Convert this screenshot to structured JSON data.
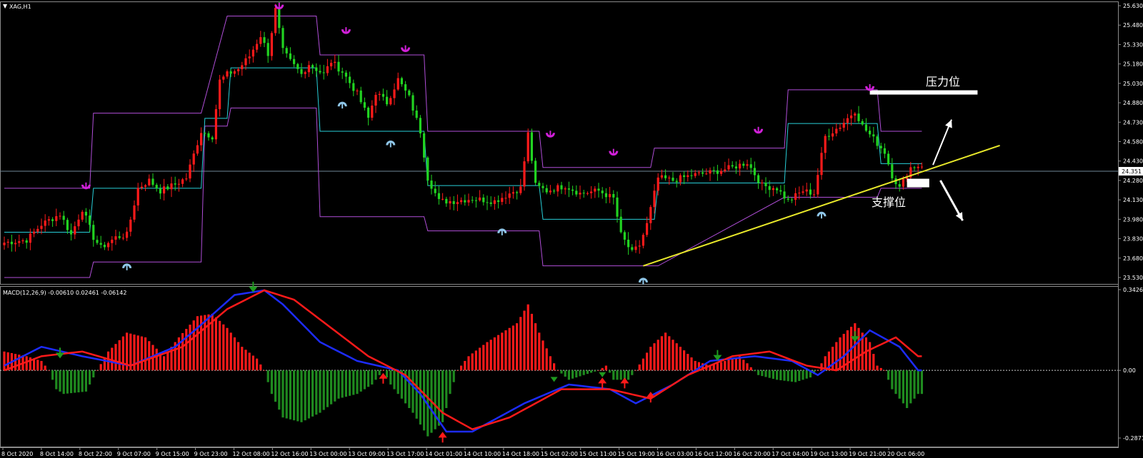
{
  "window": {
    "symbol_label": "XAG,H1",
    "macd_label": "MACD(12,26,9) -0.00610 0.02461 -0.06142"
  },
  "annotations": {
    "resistance": "压力位",
    "support": "支撑位"
  },
  "price_axis": {
    "ticks": [
      "25.630",
      "25.480",
      "25.330",
      "25.180",
      "25.030",
      "24.880",
      "24.730",
      "24.580",
      "24.430",
      "24.280",
      "24.130",
      "23.980",
      "23.830",
      "23.680",
      "23.530"
    ],
    "current": "24.351"
  },
  "macd_axis": {
    "ticks": [
      "0.34265",
      "0.00",
      "-0.28719"
    ]
  },
  "time_axis": {
    "ticks": [
      "8 Oct 2020",
      "8 Oct 14:00",
      "8 Oct 22:00",
      "9 Oct 07:00",
      "9 Oct 15:00",
      "9 Oct 23:00",
      "12 Oct 08:00",
      "12 Oct 16:00",
      "13 Oct 00:00",
      "13 Oct 09:00",
      "13 Oct 17:00",
      "14 Oct 01:00",
      "14 Oct 10:00",
      "14 Oct 18:00",
      "15 Oct 02:00",
      "15 Oct 11:00",
      "15 Oct 19:00",
      "16 Oct 03:00",
      "16 Oct 12:00",
      "16 Oct 20:00",
      "17 Oct 04:00",
      "19 Oct 13:00",
      "19 Oct 21:00",
      "20 Oct 06:00"
    ]
  },
  "colors": {
    "up": "#ff1a1a",
    "down": "#21d321",
    "upper_band": "#b04ed8",
    "mid_band": "#28cfd8",
    "trend": "#e8e82a",
    "macd": "#1d2cff",
    "signal": "#ff1a1a",
    "hist_pos": "#ff1a1a",
    "hist_neg": "#1f8a1f"
  },
  "chart_data": [
    {
      "type": "candlestick",
      "symbol": "XAG",
      "timeframe": "H1",
      "ylim": [
        23.53,
        25.63
      ],
      "current_price": 24.351,
      "anchors": [
        [
          0,
          23.8
        ],
        [
          6,
          23.82
        ],
        [
          10,
          23.94
        ],
        [
          15,
          24.02
        ],
        [
          18,
          23.86
        ],
        [
          21,
          24.06
        ],
        [
          24,
          23.84
        ],
        [
          26,
          23.76
        ],
        [
          30,
          23.84
        ],
        [
          33,
          23.86
        ],
        [
          36,
          24.22
        ],
        [
          39,
          24.28
        ],
        [
          42,
          24.2
        ],
        [
          46,
          24.25
        ],
        [
          49,
          24.3
        ],
        [
          53,
          24.66
        ],
        [
          56,
          24.62
        ],
        [
          58,
          25.05
        ],
        [
          60,
          25.1
        ],
        [
          63,
          25.14
        ],
        [
          66,
          25.24
        ],
        [
          69,
          25.4
        ],
        [
          71,
          25.26
        ],
        [
          73,
          25.6
        ],
        [
          75,
          25.28
        ],
        [
          77,
          25.2
        ],
        [
          80,
          25.1
        ],
        [
          82,
          25.18
        ],
        [
          86,
          25.1
        ],
        [
          88,
          25.2
        ],
        [
          91,
          25.12
        ],
        [
          95,
          24.95
        ],
        [
          98,
          24.76
        ],
        [
          100,
          24.96
        ],
        [
          103,
          24.88
        ],
        [
          106,
          25.06
        ],
        [
          109,
          24.92
        ],
        [
          112,
          24.66
        ],
        [
          114,
          24.3
        ],
        [
          117,
          24.12
        ],
        [
          121,
          24.12
        ],
        [
          126,
          24.14
        ],
        [
          132,
          24.12
        ],
        [
          136,
          24.18
        ],
        [
          139,
          24.22
        ],
        [
          141,
          24.64
        ],
        [
          143,
          24.24
        ],
        [
          146,
          24.2
        ],
        [
          151,
          24.24
        ],
        [
          155,
          24.18
        ],
        [
          160,
          24.2
        ],
        [
          164,
          24.14
        ],
        [
          166,
          23.86
        ],
        [
          169,
          23.72
        ],
        [
          171,
          23.78
        ],
        [
          173,
          23.94
        ],
        [
          176,
          24.3
        ],
        [
          180,
          24.28
        ],
        [
          185,
          24.32
        ],
        [
          190,
          24.34
        ],
        [
          196,
          24.38
        ],
        [
          200,
          24.42
        ],
        [
          204,
          24.24
        ],
        [
          208,
          24.22
        ],
        [
          211,
          24.12
        ],
        [
          215,
          24.2
        ],
        [
          218,
          24.18
        ],
        [
          221,
          24.62
        ],
        [
          225,
          24.7
        ],
        [
          229,
          24.82
        ],
        [
          231,
          24.7
        ],
        [
          234,
          24.6
        ],
        [
          237,
          24.5
        ],
        [
          239,
          24.32
        ],
        [
          241,
          24.22
        ],
        [
          244,
          24.38
        ],
        [
          247,
          24.4
        ]
      ],
      "upper_band_steps": [
        [
          0,
          24.22
        ],
        [
          23,
          24.22
        ],
        [
          24,
          24.8
        ],
        [
          53,
          24.8
        ],
        [
          60,
          25.55
        ],
        [
          84,
          25.55
        ],
        [
          85,
          25.25
        ],
        [
          113,
          25.25
        ],
        [
          114,
          24.66
        ],
        [
          144,
          24.66
        ],
        [
          145,
          24.38
        ],
        [
          174,
          24.38
        ],
        [
          175,
          24.53
        ],
        [
          210,
          24.53
        ],
        [
          211,
          24.98
        ],
        [
          235,
          24.98
        ],
        [
          236,
          24.66
        ],
        [
          247,
          24.66
        ]
      ],
      "mid_band_steps": [
        [
          0,
          23.88
        ],
        [
          23,
          23.88
        ],
        [
          24,
          24.22
        ],
        [
          53,
          24.22
        ],
        [
          54,
          24.76
        ],
        [
          60,
          24.76
        ],
        [
          61,
          25.15
        ],
        [
          84,
          25.15
        ],
        [
          85,
          24.66
        ],
        [
          113,
          24.66
        ],
        [
          114,
          24.24
        ],
        [
          144,
          24.24
        ],
        [
          145,
          23.98
        ],
        [
          175,
          23.98
        ],
        [
          176,
          24.26
        ],
        [
          210,
          24.26
        ],
        [
          211,
          24.72
        ],
        [
          235,
          24.72
        ],
        [
          236,
          24.41
        ],
        [
          247,
          24.41
        ]
      ],
      "lower_band_steps": [
        [
          0,
          23.53
        ],
        [
          23,
          23.53
        ],
        [
          24,
          23.65
        ],
        [
          53,
          23.65
        ],
        [
          54,
          24.7
        ],
        [
          60,
          24.7
        ],
        [
          61,
          24.84
        ],
        [
          84,
          24.84
        ],
        [
          85,
          24.0
        ],
        [
          113,
          24.0
        ],
        [
          114,
          23.89
        ],
        [
          144,
          23.89
        ],
        [
          145,
          23.62
        ],
        [
          175,
          23.62
        ],
        [
          176,
          23.62
        ],
        [
          210,
          24.15
        ],
        [
          211,
          24.15
        ],
        [
          235,
          24.15
        ],
        [
          236,
          24.22
        ],
        [
          247,
          24.22
        ]
      ],
      "fractal_up_signals": [
        [
          22,
          24.22
        ],
        [
          74,
          25.61
        ],
        [
          92,
          25.42
        ],
        [
          108,
          25.28
        ],
        [
          147,
          24.62
        ],
        [
          164,
          24.48
        ],
        [
          203,
          24.65
        ],
        [
          233,
          24.98
        ]
      ],
      "fractal_down_signals": [
        [
          33,
          23.63
        ],
        [
          91,
          24.88
        ],
        [
          104,
          24.58
        ],
        [
          134,
          23.9
        ],
        [
          172,
          23.52
        ],
        [
          220,
          24.03
        ]
      ],
      "trendline": [
        [
          172,
          23.62
        ],
        [
          268,
          24.55
        ]
      ],
      "arrows": [
        [
          250,
          24.4,
          255,
          24.75
        ],
        [
          252,
          24.28,
          258,
          23.97
        ]
      ],
      "resistance_bar": [
        233,
        262,
        24.96
      ],
      "support_bar": [
        243,
        249,
        24.26
      ]
    },
    {
      "type": "macd",
      "params": [
        12,
        26,
        9
      ],
      "values": {
        "macd": -0.0061,
        "signal": 0.02461,
        "histogram": -0.06142
      },
      "ylim": [
        -0.28719,
        0.34265
      ],
      "macd_anchors": [
        [
          0,
          0.02
        ],
        [
          10,
          0.1
        ],
        [
          21,
          0.06
        ],
        [
          34,
          0.02
        ],
        [
          46,
          0.1
        ],
        [
          52,
          0.18
        ],
        [
          62,
          0.32
        ],
        [
          70,
          0.34
        ],
        [
          75,
          0.28
        ],
        [
          85,
          0.12
        ],
        [
          95,
          0.04
        ],
        [
          106,
          0.0
        ],
        [
          112,
          -0.1
        ],
        [
          119,
          -0.26
        ],
        [
          126,
          -0.26
        ],
        [
          140,
          -0.14
        ],
        [
          152,
          -0.06
        ],
        [
          163,
          -0.08
        ],
        [
          170,
          -0.14
        ],
        [
          180,
          -0.06
        ],
        [
          190,
          0.04
        ],
        [
          202,
          0.06
        ],
        [
          212,
          0.04
        ],
        [
          219,
          -0.02
        ],
        [
          226,
          0.06
        ],
        [
          233,
          0.17
        ],
        [
          241,
          0.1
        ],
        [
          246,
          0.0
        ]
      ],
      "signal_anchors": [
        [
          0,
          0.0
        ],
        [
          10,
          0.06
        ],
        [
          21,
          0.08
        ],
        [
          34,
          0.02
        ],
        [
          48,
          0.1
        ],
        [
          60,
          0.26
        ],
        [
          70,
          0.34
        ],
        [
          78,
          0.3
        ],
        [
          88,
          0.18
        ],
        [
          98,
          0.06
        ],
        [
          108,
          -0.02
        ],
        [
          118,
          -0.18
        ],
        [
          126,
          -0.25
        ],
        [
          136,
          -0.2
        ],
        [
          150,
          -0.08
        ],
        [
          163,
          -0.08
        ],
        [
          174,
          -0.12
        ],
        [
          184,
          -0.02
        ],
        [
          196,
          0.06
        ],
        [
          206,
          0.08
        ],
        [
          216,
          0.02
        ],
        [
          224,
          0.0
        ],
        [
          232,
          0.08
        ],
        [
          240,
          0.14
        ],
        [
          246,
          0.06
        ]
      ],
      "hist_anchors": [
        [
          0,
          0.08
        ],
        [
          6,
          0.06
        ],
        [
          10,
          0.04
        ],
        [
          12,
          0.0
        ],
        [
          14,
          -0.08
        ],
        [
          16,
          -0.1
        ],
        [
          22,
          -0.09
        ],
        [
          25,
          0.0
        ],
        [
          28,
          0.08
        ],
        [
          33,
          0.16
        ],
        [
          38,
          0.14
        ],
        [
          43,
          0.06
        ],
        [
          47,
          0.14
        ],
        [
          52,
          0.23
        ],
        [
          56,
          0.24
        ],
        [
          60,
          0.18
        ],
        [
          64,
          0.1
        ],
        [
          68,
          0.05
        ],
        [
          70,
          0.0
        ],
        [
          72,
          -0.1
        ],
        [
          75,
          -0.2
        ],
        [
          80,
          -0.22
        ],
        [
          85,
          -0.18
        ],
        [
          90,
          -0.12
        ],
        [
          95,
          -0.1
        ],
        [
          99,
          -0.06
        ],
        [
          102,
          0.0
        ],
        [
          104,
          -0.06
        ],
        [
          110,
          -0.18
        ],
        [
          114,
          -0.28
        ],
        [
          118,
          -0.22
        ],
        [
          120,
          -0.1
        ],
        [
          122,
          0.0
        ],
        [
          125,
          0.06
        ],
        [
          130,
          0.12
        ],
        [
          134,
          0.16
        ],
        [
          138,
          0.2
        ],
        [
          141,
          0.28
        ],
        [
          144,
          0.16
        ],
        [
          147,
          0.06
        ],
        [
          149,
          0.0
        ],
        [
          152,
          -0.04
        ],
        [
          156,
          -0.02
        ],
        [
          160,
          0.0
        ],
        [
          162,
          0.02
        ],
        [
          164,
          -0.04
        ],
        [
          168,
          -0.04
        ],
        [
          170,
          0.0
        ],
        [
          174,
          0.1
        ],
        [
          178,
          0.16
        ],
        [
          182,
          0.1
        ],
        [
          186,
          0.04
        ],
        [
          190,
          0.02
        ],
        [
          194,
          0.04
        ],
        [
          198,
          0.06
        ],
        [
          200,
          0.03
        ],
        [
          203,
          -0.02
        ],
        [
          208,
          -0.04
        ],
        [
          213,
          -0.05
        ],
        [
          217,
          -0.03
        ],
        [
          219,
          0.0
        ],
        [
          221,
          0.06
        ],
        [
          225,
          0.14
        ],
        [
          229,
          0.2
        ],
        [
          233,
          0.12
        ],
        [
          235,
          0.02
        ],
        [
          237,
          0.0
        ],
        [
          239,
          -0.08
        ],
        [
          243,
          -0.16
        ],
        [
          246,
          -0.1
        ]
      ],
      "sell_signals": [
        [
          15,
          0.06
        ],
        [
          67,
          0.34
        ],
        [
          192,
          0.05
        ],
        [
          229,
          0.13
        ]
      ],
      "buy_signals": [
        [
          102,
          -0.02
        ],
        [
          118,
          -0.27
        ],
        [
          161,
          -0.04
        ],
        [
          167,
          -0.04
        ],
        [
          174,
          -0.1
        ]
      ],
      "small_sell_signals": [
        [
          148,
          -0.04
        ],
        [
          161,
          -0.02
        ]
      ]
    }
  ]
}
